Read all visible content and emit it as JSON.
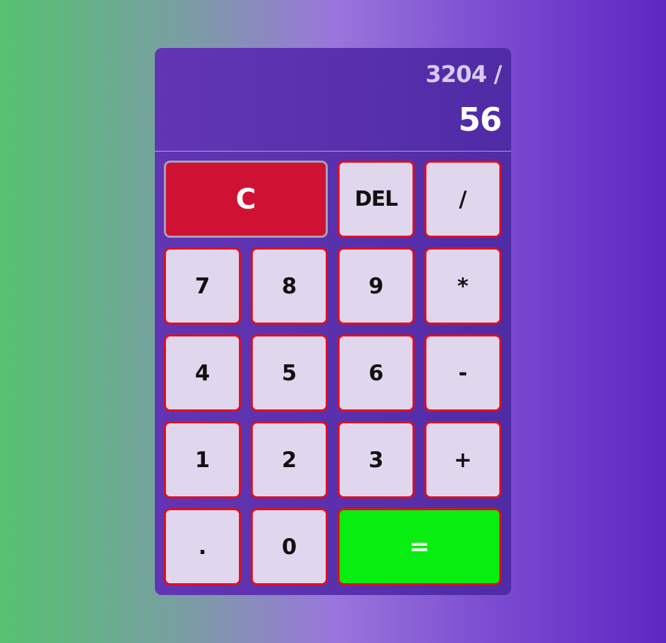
{
  "display": {
    "previous": "3204 /",
    "current": "56"
  },
  "keys": {
    "clear": "C",
    "delete": "DEL",
    "divide": "/",
    "seven": "7",
    "eight": "8",
    "nine": "9",
    "multiply": "*",
    "four": "4",
    "five": "5",
    "six": "6",
    "subtract": "-",
    "one": "1",
    "two": "2",
    "three": "3",
    "add": "+",
    "decimal": ".",
    "zero": "0",
    "equals": "="
  },
  "colors": {
    "clear_button": "#cf1234",
    "equals_button": "#08ee10",
    "key_background": "#e0d6ee",
    "key_border": "#e10e1e",
    "panel": "#5a31ad"
  }
}
